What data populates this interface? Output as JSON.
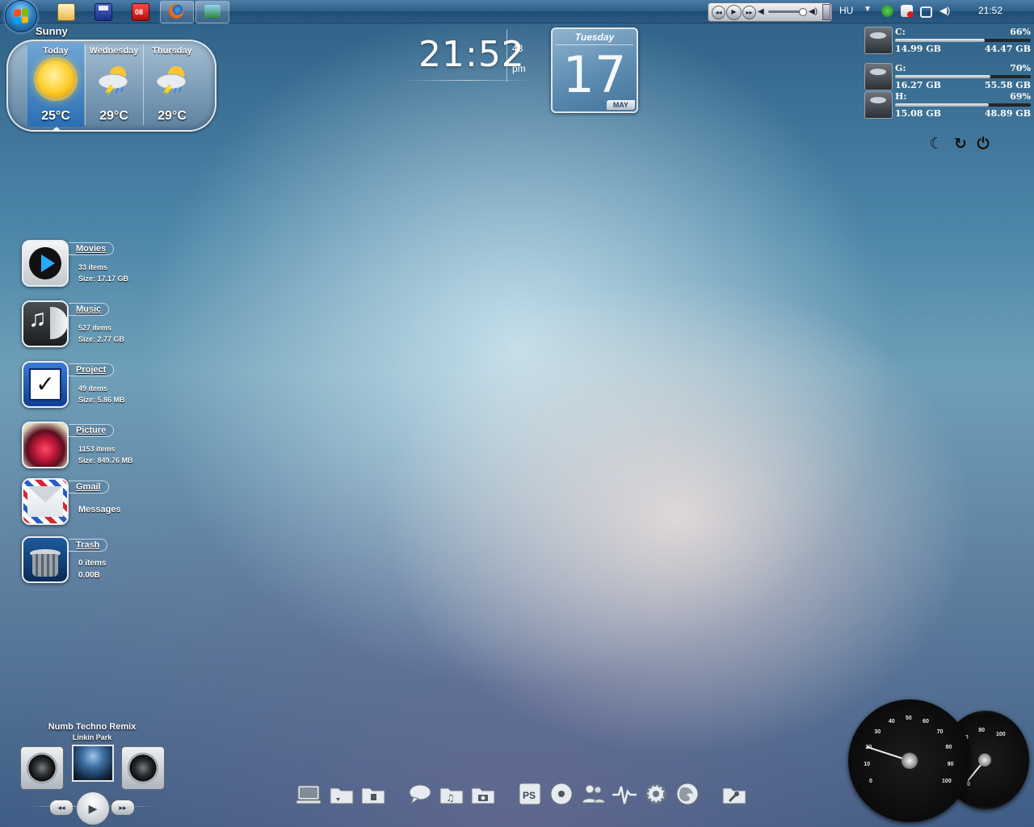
{
  "taskbar": {
    "language": "HU",
    "clock": "21:52"
  },
  "weather": {
    "city": "Sunny",
    "days": [
      {
        "label": "Today",
        "temp": "25°C",
        "condition": "sun-icon"
      },
      {
        "label": "Wednesday",
        "temp": "29°C",
        "condition": "thunderstorm-icon"
      },
      {
        "label": "Thursday",
        "temp": "29°C",
        "condition": "thunderstorm-icon"
      }
    ]
  },
  "clock": {
    "time": "21:52",
    "seconds": "43",
    "ampm": "pm"
  },
  "calendar": {
    "weekday": "Tuesday",
    "day": "17",
    "month": "MAY"
  },
  "drives": [
    {
      "letter": "C:",
      "percent": "66%",
      "fill": 0.66,
      "used": "14.99 GB",
      "free": "44.47 GB"
    },
    {
      "letter": "G:",
      "percent": "70%",
      "fill": 0.7,
      "used": "16.27 GB",
      "free": "55.58 GB"
    },
    {
      "letter": "H:",
      "percent": "69%",
      "fill": 0.69,
      "used": "15.08 GB",
      "free": "48.89 GB"
    }
  ],
  "launchers": [
    {
      "title": "Movies",
      "line1": "33 items",
      "line2": "Size: 17.17 GB",
      "icon": "play-icon"
    },
    {
      "title": "Music",
      "line1": "527 items",
      "line2": "Size: 2.77 GB",
      "icon": "music-note-icon"
    },
    {
      "title": "Project",
      "line1": "49 items",
      "line2": "Size: 5.86 MB",
      "icon": "checkmark-icon"
    },
    {
      "title": "Picture",
      "line1": "1153 items",
      "line2": "Size: 849.76 MB",
      "icon": "flower-photo-icon"
    },
    {
      "title": "Gmail",
      "line1": "Messages",
      "line2": "",
      "icon": "envelope-icon"
    },
    {
      "title": "Trash",
      "line1": "0 items",
      "line2": "0.00B",
      "icon": "trash-can-icon"
    }
  ],
  "music_player": {
    "title": "Numb Techno Remix",
    "artist": "Linkin Park"
  },
  "dock": [
    "computer-icon",
    "folder-download-icon",
    "folder-documents-icon",
    "chat-bubble-icon",
    "folder-music-icon",
    "folder-pictures-icon",
    "photoshop-icon",
    "disc-icon",
    "people-icon",
    "activity-monitor-icon",
    "settings-gear-icon",
    "firefox-icon",
    "folder-tools-icon"
  ],
  "dock_ps_label": "PS",
  "gauges": {
    "speed_ticks": [
      "0",
      "10",
      "20",
      "30",
      "40",
      "50",
      "60",
      "70",
      "80",
      "90",
      "100"
    ],
    "small_ticks": [
      "0",
      "20",
      "40",
      "60",
      "80",
      "100"
    ],
    "cpu_value": 20,
    "ram_value": 5
  },
  "colors": {
    "taskbar": "#2d5f89",
    "weather_today": "#2a6fb4",
    "calendar": "#5d8cb1"
  }
}
